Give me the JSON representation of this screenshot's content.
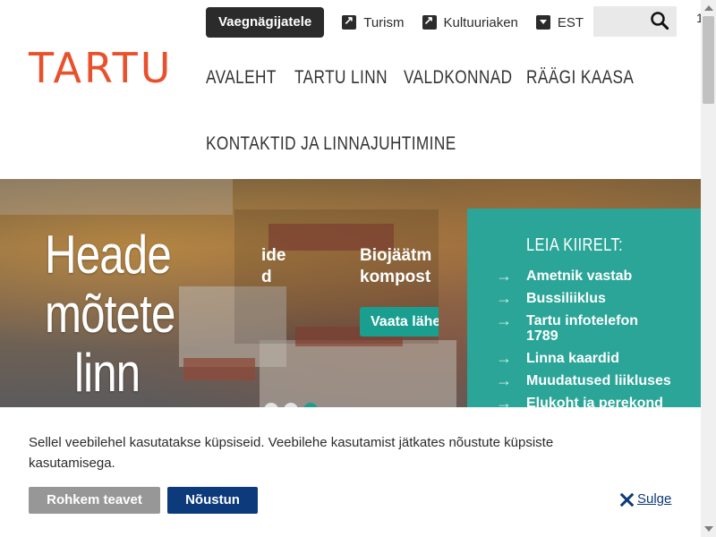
{
  "header": {
    "logo": "TARTU",
    "impaired_button": "Vaegnägijatele",
    "links": [
      {
        "label": "Turism",
        "icon": "external-link-icon"
      },
      {
        "label": "Kultuuriaken",
        "icon": "external-link-icon"
      },
      {
        "label": "EST",
        "icon": "chevron-down-icon"
      }
    ],
    "edge_char": "1"
  },
  "nav": {
    "items": [
      "AVALEHT",
      "TARTU LINN",
      "VALDKONNAD",
      "RÄÄGI KAASA",
      "KONTAKTID JA LINNAJUHTIMINE"
    ]
  },
  "hero": {
    "title": "Heade mõtete linn",
    "slide_left": "ide\nd",
    "slide_right": "Biojäätm\nkompost",
    "slide_button": "Vaata lähe"
  },
  "quick_links": {
    "title": "LEIA KIIRELT:",
    "items": [
      "Ametnik vastab",
      "Bussiliiklus",
      "Tartu infotelefon 1789",
      "Linna kaardid",
      "Muudatused liikluses",
      "Elukoht ja perekond"
    ]
  },
  "cookie": {
    "text": "Sellel veebilehel kasutatakse küpsiseid.  Veebilehe kasutamist jätkates nõustute küpsiste kasutamisega.",
    "more_button": "Rohkem teavet",
    "agree_button": "Nõustun",
    "close_label": "Sulge"
  },
  "colors": {
    "brand": "#e8512c",
    "teal": "#2aa597",
    "navy": "#0d3a7a"
  }
}
